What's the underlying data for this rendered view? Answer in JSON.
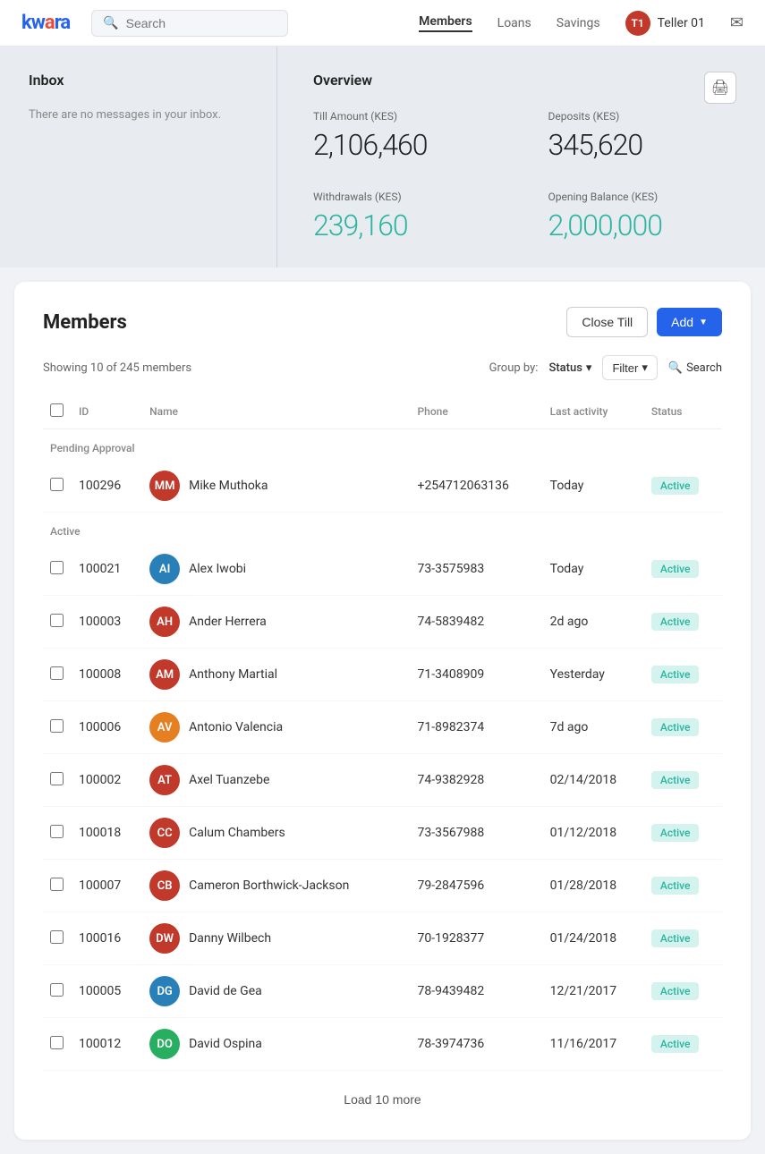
{
  "app": {
    "logo": "kwara",
    "logo_accent": "a"
  },
  "navbar": {
    "search_placeholder": "Search",
    "links": [
      {
        "label": "Members",
        "active": true
      },
      {
        "label": "Loans",
        "active": false
      },
      {
        "label": "Savings",
        "active": false
      }
    ],
    "user": {
      "name": "Teller 01",
      "initials": "T1"
    }
  },
  "inbox": {
    "title": "Inbox",
    "empty_message": "There are no messages in your inbox."
  },
  "overview": {
    "title": "Overview",
    "stats": [
      {
        "label": "Till Amount (KES)",
        "value": "2,106,460",
        "teal": false
      },
      {
        "label": "Deposits (KES)",
        "value": "345,620",
        "teal": false
      },
      {
        "label": "Withdrawals (KES)",
        "value": "239,160",
        "teal": true
      },
      {
        "label": "Opening Balance (KES)",
        "value": "2,000,000",
        "teal": true
      }
    ]
  },
  "members": {
    "title": "Members",
    "close_till_label": "Close Till",
    "add_label": "Add",
    "showing": "Showing 10 of 245 members",
    "group_by_label": "Group by:",
    "group_by_value": "Status",
    "filter_label": "Filter",
    "search_label": "Search",
    "columns": [
      "ID",
      "Name",
      "Phone",
      "Last activity",
      "Status"
    ],
    "groups": [
      {
        "name": "Pending Approval",
        "rows": [
          {
            "id": "100296",
            "name": "Mike Muthoka",
            "phone": "+254712063136",
            "last_activity": "Today",
            "status": "Active",
            "color": "#c0392b",
            "initials": "MM"
          }
        ]
      },
      {
        "name": "Active",
        "rows": [
          {
            "id": "100021",
            "name": "Alex Iwobi",
            "phone": "73-3575983",
            "last_activity": "Today",
            "status": "Active",
            "color": "#2980b9",
            "initials": "AI"
          },
          {
            "id": "100003",
            "name": "Ander Herrera",
            "phone": "74-5839482",
            "last_activity": "2d ago",
            "status": "Active",
            "color": "#c0392b",
            "initials": "AH"
          },
          {
            "id": "100008",
            "name": "Anthony Martial",
            "phone": "71-3408909",
            "last_activity": "Yesterday",
            "status": "Active",
            "color": "#c0392b",
            "initials": "AM"
          },
          {
            "id": "100006",
            "name": "Antonio Valencia",
            "phone": "71-8982374",
            "last_activity": "7d ago",
            "status": "Active",
            "color": "#e67e22",
            "initials": "AV"
          },
          {
            "id": "100002",
            "name": "Axel Tuanzebe",
            "phone": "74-9382928",
            "last_activity": "02/14/2018",
            "status": "Active",
            "color": "#c0392b",
            "initials": "AT"
          },
          {
            "id": "100018",
            "name": "Calum Chambers",
            "phone": "73-3567988",
            "last_activity": "01/12/2018",
            "status": "Active",
            "color": "#c0392b",
            "initials": "CC"
          },
          {
            "id": "100007",
            "name": "Cameron Borthwick-Jackson",
            "phone": "79-2847596",
            "last_activity": "01/28/2018",
            "status": "Active",
            "color": "#c0392b",
            "initials": "CB"
          },
          {
            "id": "100016",
            "name": "Danny Wilbech",
            "phone": "70-1928377",
            "last_activity": "01/24/2018",
            "status": "Active",
            "color": "#c0392b",
            "initials": "DW"
          },
          {
            "id": "100005",
            "name": "David de Gea",
            "phone": "78-9439482",
            "last_activity": "12/21/2017",
            "status": "Active",
            "color": "#2980b9",
            "initials": "DG"
          },
          {
            "id": "100012",
            "name": "David Ospina",
            "phone": "78-3974736",
            "last_activity": "11/16/2017",
            "status": "Active",
            "color": "#27ae60",
            "initials": "DO"
          }
        ]
      }
    ],
    "load_more_label": "Load 10 more"
  }
}
